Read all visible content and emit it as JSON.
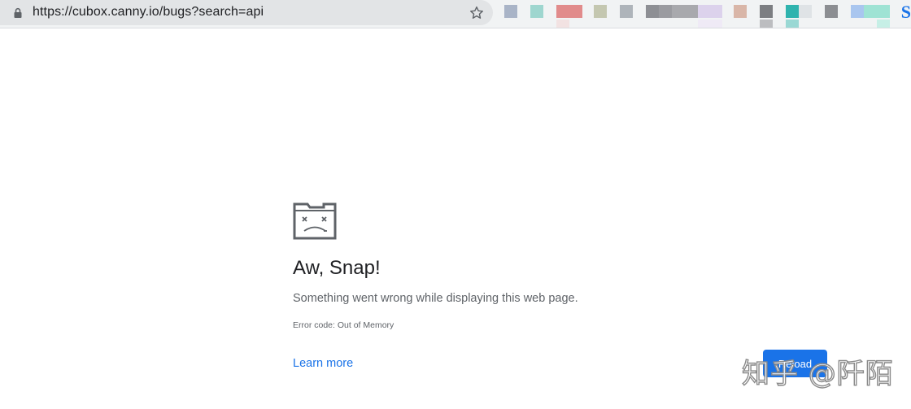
{
  "browser": {
    "url": "https://cubox.canny.io/bugs?search=api",
    "lock_icon": "lock-icon",
    "star_icon": "star-icon",
    "bookmark_letter": "S"
  },
  "error_page": {
    "icon": "sad-tab-icon",
    "title": "Aw, Snap!",
    "message": "Something went wrong while displaying this web page.",
    "error_code": "Error code: Out of Memory",
    "learn_more": "Learn more",
    "reload_label": "Reload"
  },
  "watermark": "知乎 @阡陌",
  "colors": {
    "accent": "#1a73e8",
    "omnibox": "#e2e4e6",
    "title_text": "#202124",
    "body_text": "#5f6368"
  }
}
